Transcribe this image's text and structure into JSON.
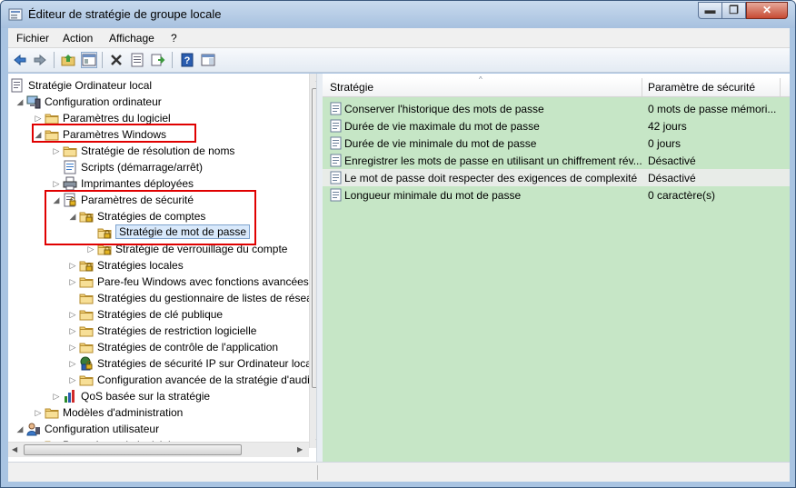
{
  "window": {
    "title": "Éditeur de stratégie de groupe locale",
    "min": "▬",
    "max": "❐",
    "close": "✕"
  },
  "menu": [
    "Fichier",
    "Action",
    "Affichage",
    "?"
  ],
  "toolbar": {
    "icons": [
      "back-icon",
      "forward-icon",
      "up-folder-icon",
      "show-hide-tree-icon",
      "delete-icon",
      "properties-icon",
      "export-list-icon",
      "help-icon",
      "toggle-view-icon"
    ]
  },
  "tree": [
    {
      "label": "Stratégie Ordinateur local",
      "level": 0,
      "expander": "",
      "icon": "computer-policy-icon"
    },
    {
      "label": "Configuration ordinateur",
      "level": 1,
      "expander": "◢",
      "icon": "computer-icon"
    },
    {
      "label": "Paramètres du logiciel",
      "level": 2,
      "expander": "▷",
      "icon": "folder-icon"
    },
    {
      "label": "Paramètres Windows",
      "level": 2,
      "expander": "◢",
      "icon": "folder-icon"
    },
    {
      "label": "Stratégie de résolution de noms",
      "level": 3,
      "expander": "▷",
      "icon": "folder-icon"
    },
    {
      "label": "Scripts (démarrage/arrêt)",
      "level": 3,
      "expander": "",
      "icon": "script-icon"
    },
    {
      "label": "Imprimantes déployées",
      "level": 3,
      "expander": "▷",
      "icon": "printer-icon"
    },
    {
      "label": "Paramètres de sécurité",
      "level": 3,
      "expander": "◢",
      "icon": "security-settings-icon"
    },
    {
      "label": "Stratégies de comptes",
      "level": 4,
      "expander": "◢",
      "icon": "locked-folder-icon"
    },
    {
      "label": "Stratégie de mot de passe",
      "level": 5,
      "expander": "",
      "icon": "locked-folder-icon"
    },
    {
      "label": "Stratégie de verrouillage du compte",
      "level": 5,
      "expander": "▷",
      "icon": "locked-folder-icon"
    },
    {
      "label": "Stratégies locales",
      "level": 4,
      "expander": "▷",
      "icon": "locked-folder-icon"
    },
    {
      "label": "Pare-feu Windows avec fonctions avancées",
      "level": 4,
      "expander": "▷",
      "icon": "folder-icon"
    },
    {
      "label": "Stratégies du gestionnaire de listes de réseaux",
      "level": 4,
      "expander": "",
      "icon": "folder-icon"
    },
    {
      "label": "Stratégies de clé publique",
      "level": 4,
      "expander": "▷",
      "icon": "folder-icon"
    },
    {
      "label": "Stratégies de restriction logicielle",
      "level": 4,
      "expander": "▷",
      "icon": "folder-icon"
    },
    {
      "label": "Stratégies de contrôle de l'application",
      "level": 4,
      "expander": "▷",
      "icon": "folder-icon"
    },
    {
      "label": "Stratégies de sécurité IP sur Ordinateur local",
      "level": 4,
      "expander": "▷",
      "icon": "ip-security-icon"
    },
    {
      "label": "Configuration avancée de la stratégie d'audit",
      "level": 4,
      "expander": "▷",
      "icon": "folder-icon"
    },
    {
      "label": "QoS basée sur la stratégie",
      "level": 3,
      "expander": "▷",
      "icon": "qos-chart-icon"
    },
    {
      "label": "Modèles d'administration",
      "level": 2,
      "expander": "▷",
      "icon": "folder-icon"
    },
    {
      "label": "Configuration utilisateur",
      "level": 1,
      "expander": "◢",
      "icon": "user-icon"
    },
    {
      "label": "Paramètres du logiciel",
      "level": 2,
      "expander": "▷",
      "icon": "folder-icon"
    }
  ],
  "selected_index": 9,
  "list": {
    "columns": [
      "Stratégie",
      "Paramètre de sécurité"
    ],
    "sort_indicator": "^",
    "rows": [
      {
        "name": "Conserver l'historique des mots de passe",
        "value": "0 mots de passe mémori..."
      },
      {
        "name": "Durée de vie maximale du mot de passe",
        "value": "42 jours"
      },
      {
        "name": "Durée de vie minimale du mot de passe",
        "value": "0 jours"
      },
      {
        "name": "Enregistrer les mots de passe en utilisant un chiffrement rév...",
        "value": "Désactivé"
      },
      {
        "name": "Le mot de passe doit respecter des exigences de complexité",
        "value": "Désactivé"
      },
      {
        "name": "Longueur minimale du mot de passe",
        "value": "0 caractère(s)"
      }
    ],
    "highlighted_index": 4
  },
  "colors": {
    "highlight_box": "#e00000",
    "list_background": "#c6e6c6",
    "selection": "#d9e9fb"
  }
}
